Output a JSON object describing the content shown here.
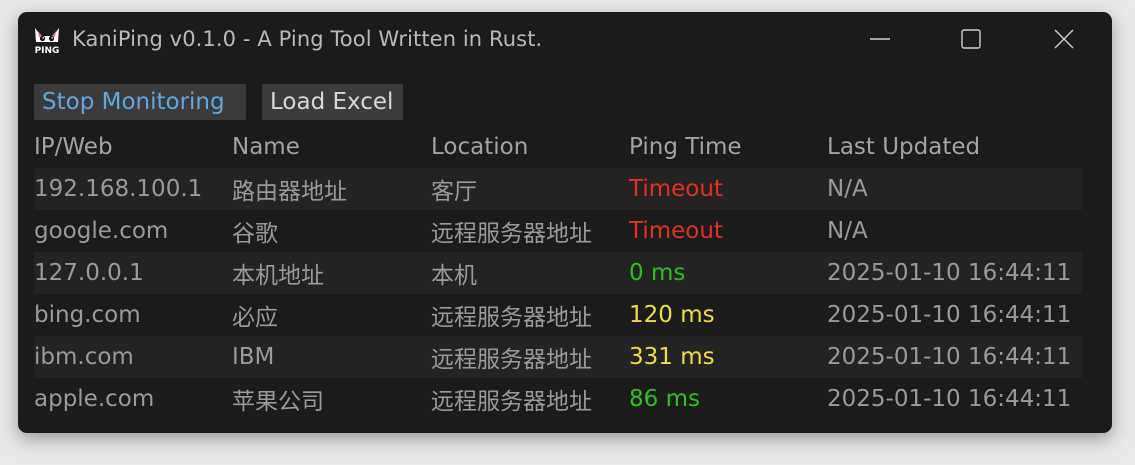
{
  "window": {
    "title": "KaniPing v0.1.0 - A Ping Tool Written in Rust.",
    "icon_text": "PING",
    "controls": {
      "minimize": "minimize-icon",
      "maximize": "maximize-icon",
      "close": "close-icon"
    }
  },
  "toolbar": {
    "stop_label": "Stop Monitoring",
    "load_label": "Load Excel"
  },
  "table": {
    "columns": [
      "IP/Web",
      "Name",
      "Location",
      "Ping Time",
      "Last Updated"
    ],
    "rows": [
      {
        "ip": "192.168.100.1",
        "name": "路由器地址",
        "location": "客厅",
        "ping": "Timeout",
        "status": "timeout",
        "updated": "N/A"
      },
      {
        "ip": "google.com",
        "name": "谷歌",
        "location": "远程服务器地址",
        "ping": "Timeout",
        "status": "timeout",
        "updated": "N/A"
      },
      {
        "ip": "127.0.0.1",
        "name": "本机地址",
        "location": "本机",
        "ping": "0 ms",
        "status": "good",
        "updated": "2025-01-10 16:44:11"
      },
      {
        "ip": "bing.com",
        "name": "必应",
        "location": "远程服务器地址",
        "ping": "120 ms",
        "status": "slow",
        "updated": "2025-01-10 16:44:11"
      },
      {
        "ip": "ibm.com",
        "name": "IBM",
        "location": "远程服务器地址",
        "ping": "331 ms",
        "status": "slow",
        "updated": "2025-01-10 16:44:11"
      },
      {
        "ip": "apple.com",
        "name": "苹果公司",
        "location": "远程服务器地址",
        "ping": "86 ms",
        "status": "good",
        "updated": "2025-01-10 16:44:11"
      }
    ]
  },
  "colors": {
    "timeout": "#e0321e",
    "good": "#29c41a",
    "slow": "#f1df3a",
    "accent": "#5fa9dc"
  }
}
